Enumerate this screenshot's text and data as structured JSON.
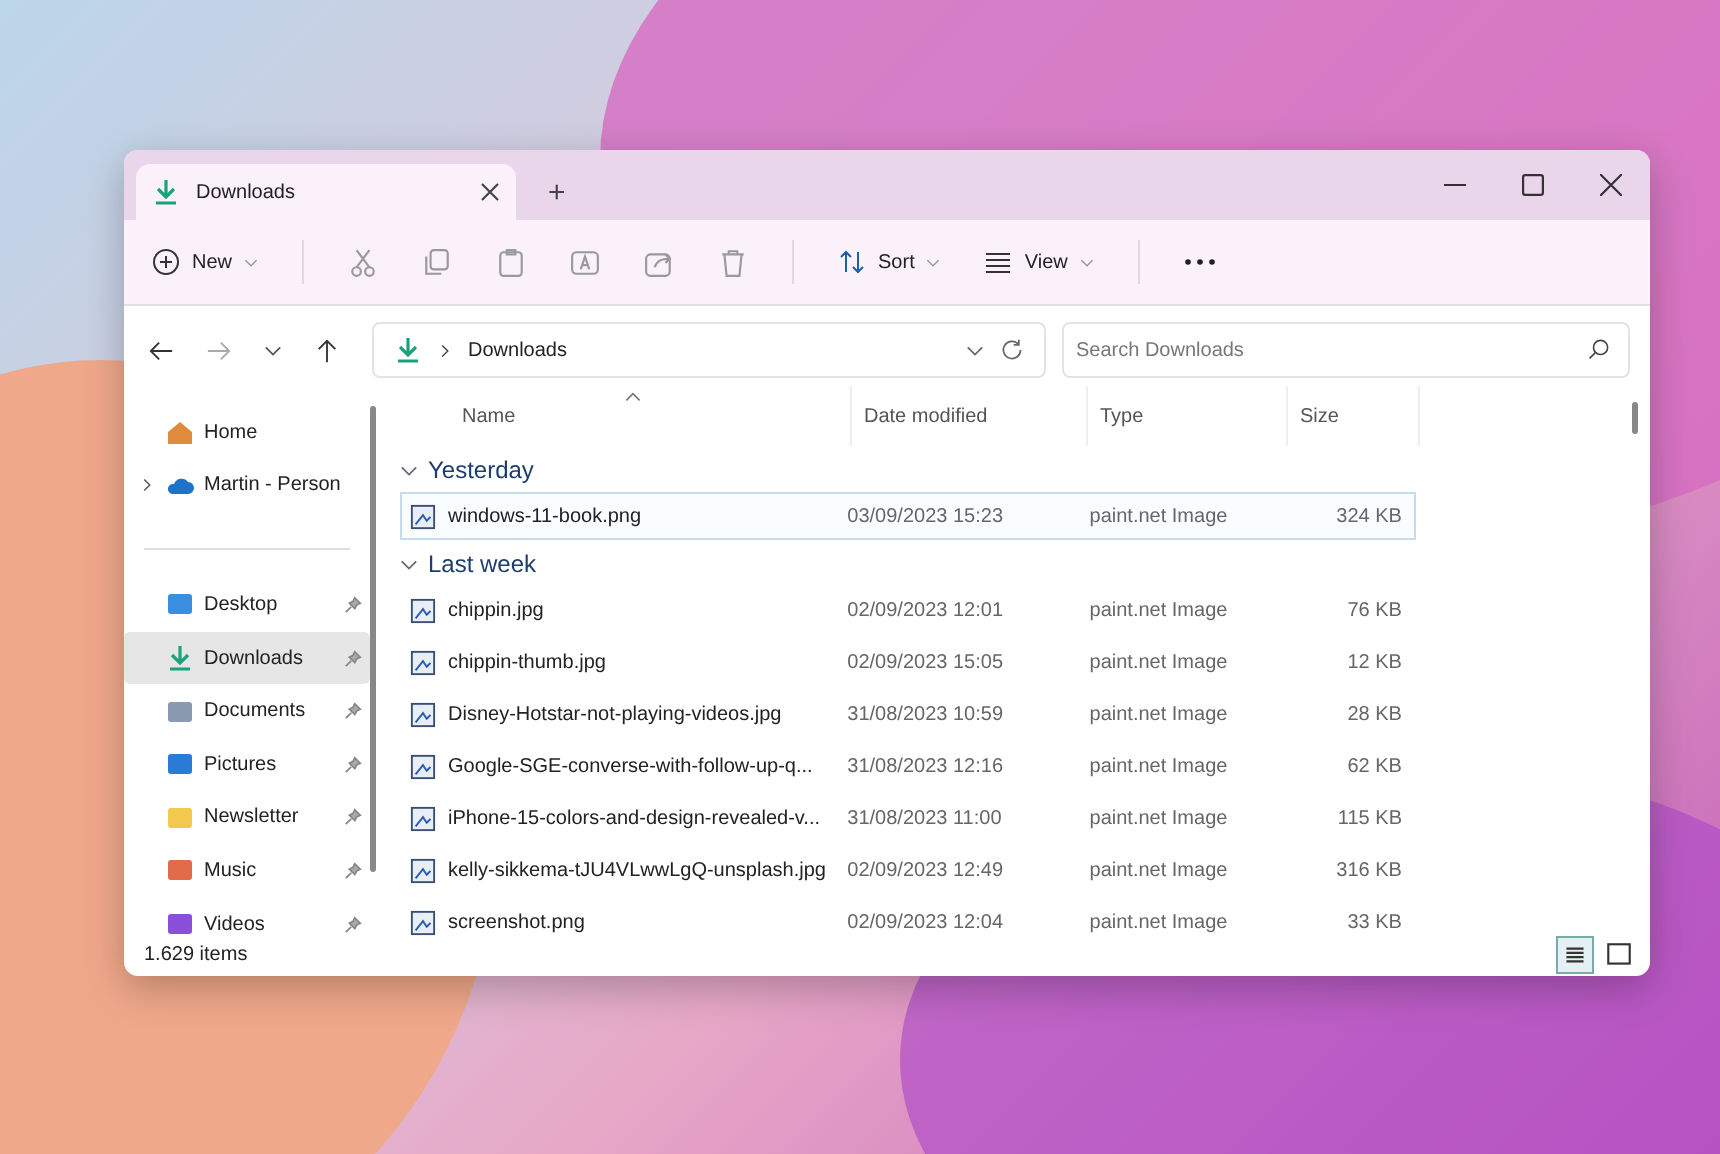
{
  "window": {
    "tab_title": "Downloads",
    "new_tab": "+"
  },
  "toolbar": {
    "new": "New",
    "sort": "Sort",
    "view": "View"
  },
  "address": {
    "location": "Downloads",
    "search_placeholder": "Search Downloads"
  },
  "sidebar": {
    "items": [
      {
        "label": "Home",
        "kind": "plain",
        "selected": false
      },
      {
        "label": "Martin - Person",
        "kind": "tree",
        "selected": false
      },
      {
        "label": "Desktop",
        "kind": "pinned",
        "selected": false
      },
      {
        "label": "Downloads",
        "kind": "pinned",
        "selected": true
      },
      {
        "label": "Documents",
        "kind": "pinned",
        "selected": false
      },
      {
        "label": "Pictures",
        "kind": "pinned",
        "selected": false
      },
      {
        "label": "Newsletter",
        "kind": "pinned",
        "selected": false
      },
      {
        "label": "Music",
        "kind": "pinned",
        "selected": false
      },
      {
        "label": "Videos",
        "kind": "pinned",
        "selected": false
      }
    ]
  },
  "table": {
    "columns": [
      "Name",
      "Date modified",
      "Type",
      "Size"
    ],
    "groups": [
      {
        "title": "Yesterday",
        "rows": [
          {
            "name": "windows-11-book.png",
            "date": "03/09/2023 15:23",
            "type": "paint.net Image",
            "size": "324 KB",
            "selected": true
          }
        ]
      },
      {
        "title": "Last week",
        "rows": [
          {
            "name": "chippin.jpg",
            "date": "02/09/2023 12:01",
            "type": "paint.net Image",
            "size": "76 KB",
            "selected": false
          },
          {
            "name": "chippin-thumb.jpg",
            "date": "02/09/2023 15:05",
            "type": "paint.net Image",
            "size": "12 KB",
            "selected": false
          },
          {
            "name": "Disney-Hotstar-not-playing-videos.jpg",
            "date": "31/08/2023 10:59",
            "type": "paint.net Image",
            "size": "28 KB",
            "selected": false
          },
          {
            "name": "Google-SGE-converse-with-follow-up-q...",
            "date": "31/08/2023 12:16",
            "type": "paint.net Image",
            "size": "62 KB",
            "selected": false
          },
          {
            "name": "iPhone-15-colors-and-design-revealed-v...",
            "date": "31/08/2023 11:00",
            "type": "paint.net Image",
            "size": "115 KB",
            "selected": false
          },
          {
            "name": "kelly-sikkema-tJU4VLwwLgQ-unsplash.jpg",
            "date": "02/09/2023 12:49",
            "type": "paint.net Image",
            "size": "316 KB",
            "selected": false
          },
          {
            "name": "screenshot.png",
            "date": "02/09/2023 12:04",
            "type": "paint.net Image",
            "size": "33 KB",
            "selected": false
          }
        ]
      }
    ]
  },
  "status_bar": {
    "item_count": "1.629 items",
    "view_buttons": [
      {
        "kind": "details",
        "selected": true
      },
      {
        "kind": "preview",
        "selected": false
      }
    ]
  }
}
